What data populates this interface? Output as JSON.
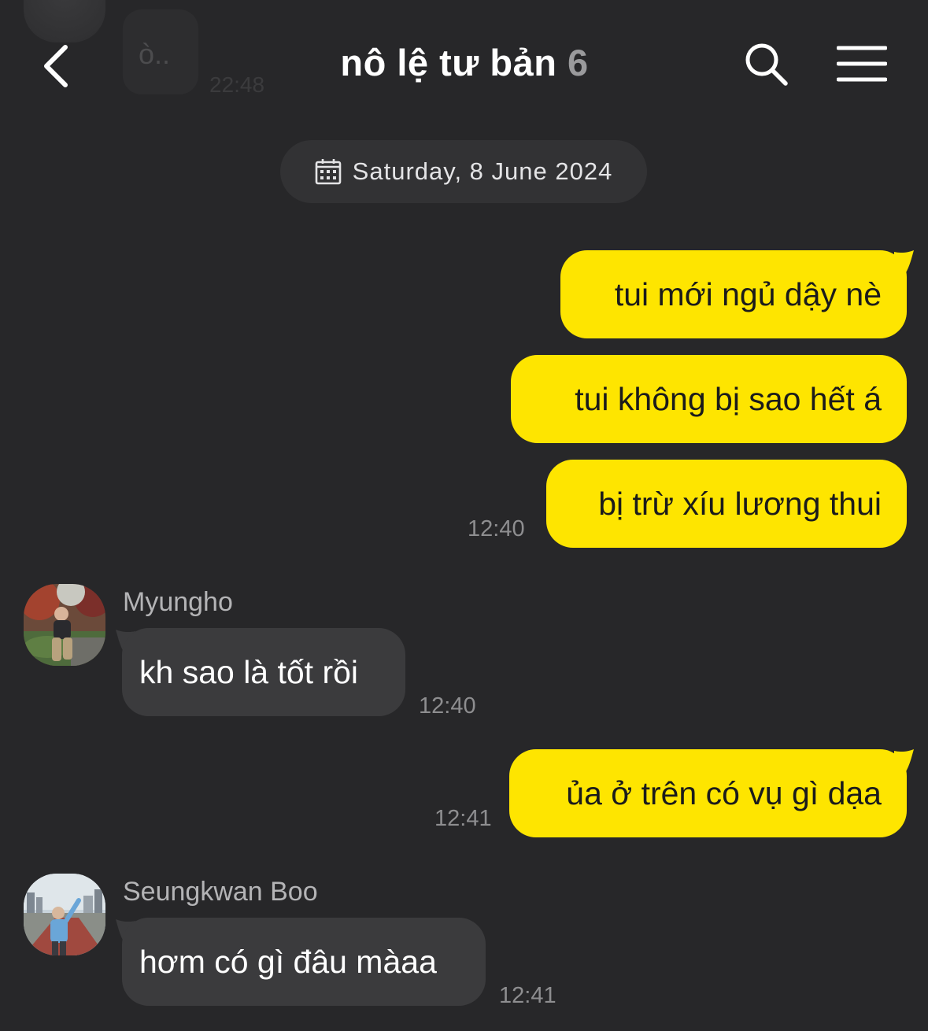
{
  "previous": {
    "text": "ò..",
    "time": "22:48"
  },
  "header": {
    "title": "nô lệ tư bản",
    "member_count": "6",
    "back_icon": "chevron-left-icon",
    "search_icon": "search-icon",
    "menu_icon": "hamburger-menu-icon"
  },
  "date_divider": {
    "icon": "calendar-icon",
    "label": "Saturday, 8 June 2024"
  },
  "messages": [
    {
      "from": "me",
      "text": "tui mới ngủ dậy nè"
    },
    {
      "from": "me",
      "text": "tui không bị sao hết á"
    },
    {
      "from": "me",
      "text": "bị trừ xíu lương thui",
      "time": "12:40"
    },
    {
      "from": "Myungho",
      "sender": "Myungho",
      "text": "kh sao là tốt rồi",
      "time": "12:40"
    },
    {
      "from": "me",
      "text": "ủa ở trên có vụ gì dạa",
      "time": "12:41"
    },
    {
      "from": "Seungkwan Boo",
      "sender": "Seungkwan Boo",
      "text": "hơm có gì đâu màaa",
      "time": "12:41"
    }
  ],
  "colors": {
    "background": "#272729",
    "outgoing_bubble": "#fee500",
    "incoming_bubble": "#3b3b3d",
    "date_pill": "#323234",
    "timestamp": "#8e8e90"
  }
}
